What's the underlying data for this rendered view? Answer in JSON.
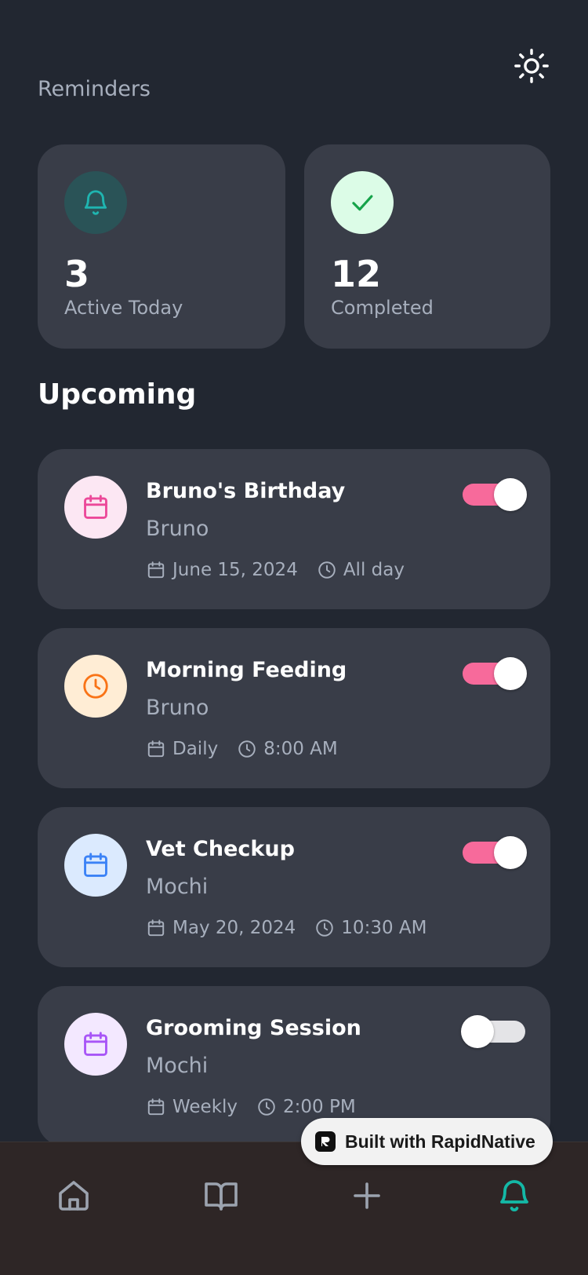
{
  "header": {
    "subtitle": "Reminders",
    "theme_icon": "sun-icon"
  },
  "stats": [
    {
      "value": "3",
      "label": "Active Today",
      "icon": "bell-icon",
      "circle_color": "#2a5357",
      "icon_color": "#1fb5b0"
    },
    {
      "value": "12",
      "label": "Completed",
      "icon": "check-icon",
      "circle_color": "#dcfce7",
      "icon_color": "#16a34a"
    }
  ],
  "section": {
    "title": "Upcoming"
  },
  "reminders": [
    {
      "title": "Bruno's Birthday",
      "pet": "Bruno",
      "date": "June 15, 2024",
      "time": "All day",
      "icon": "calendar-icon",
      "circle_color": "#fce7f3",
      "icon_color": "#ec4899",
      "enabled": true
    },
    {
      "title": "Morning Feeding",
      "pet": "Bruno",
      "date": "Daily",
      "time": "8:00 AM",
      "icon": "clock-icon",
      "circle_color": "#ffedd5",
      "icon_color": "#f97316",
      "enabled": true
    },
    {
      "title": "Vet Checkup",
      "pet": "Mochi",
      "date": "May 20, 2024",
      "time": "10:30 AM",
      "icon": "calendar-icon",
      "circle_color": "#dbeafe",
      "icon_color": "#3b82f6",
      "enabled": true
    },
    {
      "title": "Grooming Session",
      "pet": "Mochi",
      "date": "Weekly",
      "time": "2:00 PM",
      "icon": "calendar-icon",
      "circle_color": "#f3e8ff",
      "icon_color": "#a855f7",
      "enabled": false
    }
  ],
  "nav": {
    "items": [
      {
        "icon": "home-icon",
        "active": false
      },
      {
        "icon": "book-icon",
        "active": false
      },
      {
        "icon": "plus-icon",
        "active": false
      },
      {
        "icon": "bell-icon",
        "active": true
      }
    ],
    "active_color": "#14b8a6",
    "inactive_color": "#9ca3af"
  },
  "badge": {
    "text": "Built with RapidNative"
  },
  "colors": {
    "background": "#222731",
    "card": "#393d48",
    "toggle_on": "#f76a9b",
    "toggle_off": "#e4e4e7",
    "nav_background": "#2e2626"
  }
}
